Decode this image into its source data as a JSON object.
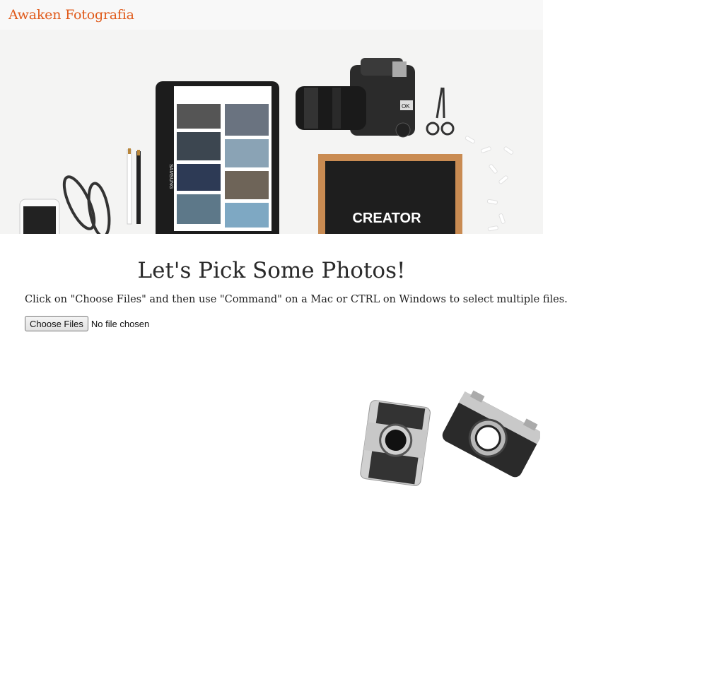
{
  "navbar": {
    "brand": "Awaken Fotografia"
  },
  "hero": {
    "tablet_brand": "SAMSUNG",
    "letterboard_text": "CREATOR",
    "camera_badge": "OK"
  },
  "main": {
    "title": "Let's Pick Some Photos!",
    "instructions": "Click on \"Choose Files\" and then use \"Command\" on a Mac or CTRL on Windows to select multiple files.",
    "file_button_label": "Choose Files",
    "file_status": "No file chosen"
  },
  "colors": {
    "brand": "#e05a1a",
    "navbar_bg": "#f8f8f8"
  }
}
